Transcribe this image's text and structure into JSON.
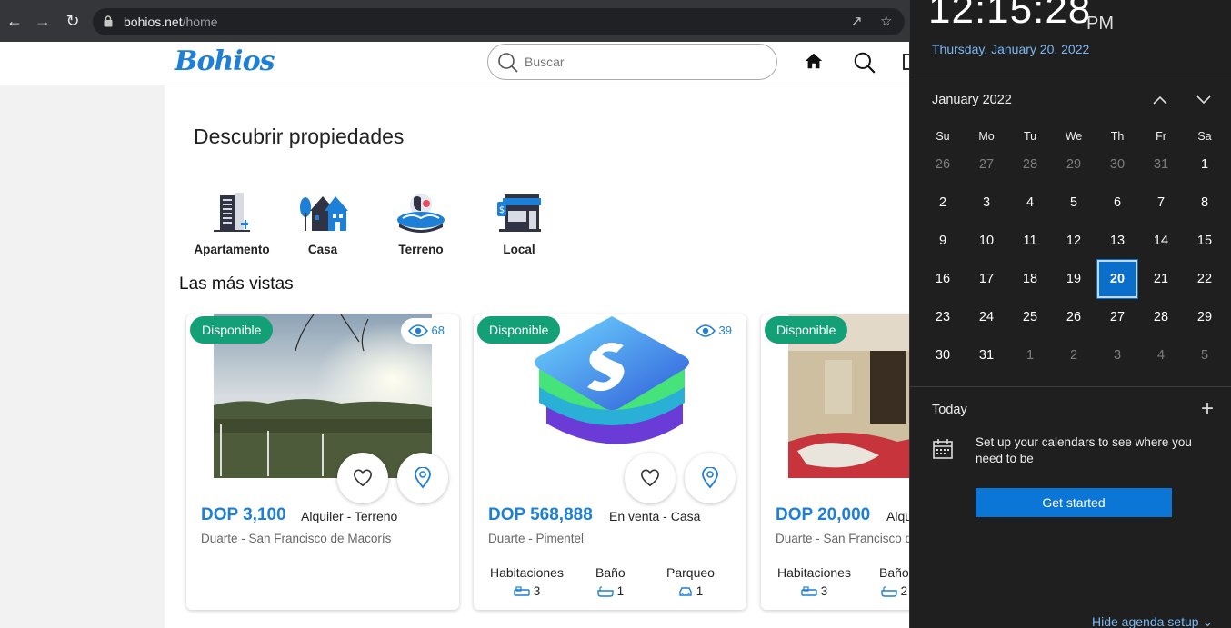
{
  "browser": {
    "url_host": "bohios.net",
    "url_path": "/home"
  },
  "site": {
    "logo": "Bohios",
    "search_placeholder": "Buscar"
  },
  "main": {
    "title": "Descubrir propiedades",
    "categories": [
      {
        "label": "Apartamento",
        "icon": "apartment-icon"
      },
      {
        "label": "Casa",
        "icon": "house-icon"
      },
      {
        "label": "Terreno",
        "icon": "land-icon"
      },
      {
        "label": "Local",
        "icon": "store-icon"
      }
    ],
    "most_viewed_title": "Las más vistas",
    "cards": [
      {
        "badge": "Disponible",
        "views": "68",
        "price": "DOP 3,100",
        "type": "Alquiler - Terreno",
        "location": "Duarte - San Francisco de Macorís",
        "features": []
      },
      {
        "badge": "Disponible",
        "views": "39",
        "price": "DOP 568,888",
        "type": "En venta - Casa",
        "location": "Duarte - Pimentel",
        "features": [
          {
            "label": "Habitaciones",
            "value": "3"
          },
          {
            "label": "Baño",
            "value": "1"
          },
          {
            "label": "Parqueo",
            "value": "1"
          }
        ]
      },
      {
        "badge": "Disponible",
        "views": "",
        "price": "DOP 20,000",
        "type": "Alqu",
        "location": "Duarte - San Francisco d",
        "features": [
          {
            "label": "Habitaciones",
            "value": "3"
          },
          {
            "label": "Baño",
            "value": "2"
          }
        ]
      }
    ]
  },
  "flyout": {
    "time": "12:15:28",
    "ampm": "PM",
    "date_long": "Thursday, January 20, 2022",
    "month_label": "January 2022",
    "dow": [
      "Su",
      "Mo",
      "Tu",
      "We",
      "Th",
      "Fr",
      "Sa"
    ],
    "weeks": [
      [
        "26",
        "27",
        "28",
        "29",
        "30",
        "31",
        "1"
      ],
      [
        "2",
        "3",
        "4",
        "5",
        "6",
        "7",
        "8"
      ],
      [
        "9",
        "10",
        "11",
        "12",
        "13",
        "14",
        "15"
      ],
      [
        "16",
        "17",
        "18",
        "19",
        "20",
        "21",
        "22"
      ],
      [
        "23",
        "24",
        "25",
        "26",
        "27",
        "28",
        "29"
      ],
      [
        "30",
        "31",
        "1",
        "2",
        "3",
        "4",
        "5"
      ]
    ],
    "selected_day": "20",
    "today_label": "Today",
    "setup_text": "Set up your calendars to see where you need to be",
    "get_started": "Get started",
    "hide_agenda": "Hide agenda setup"
  }
}
